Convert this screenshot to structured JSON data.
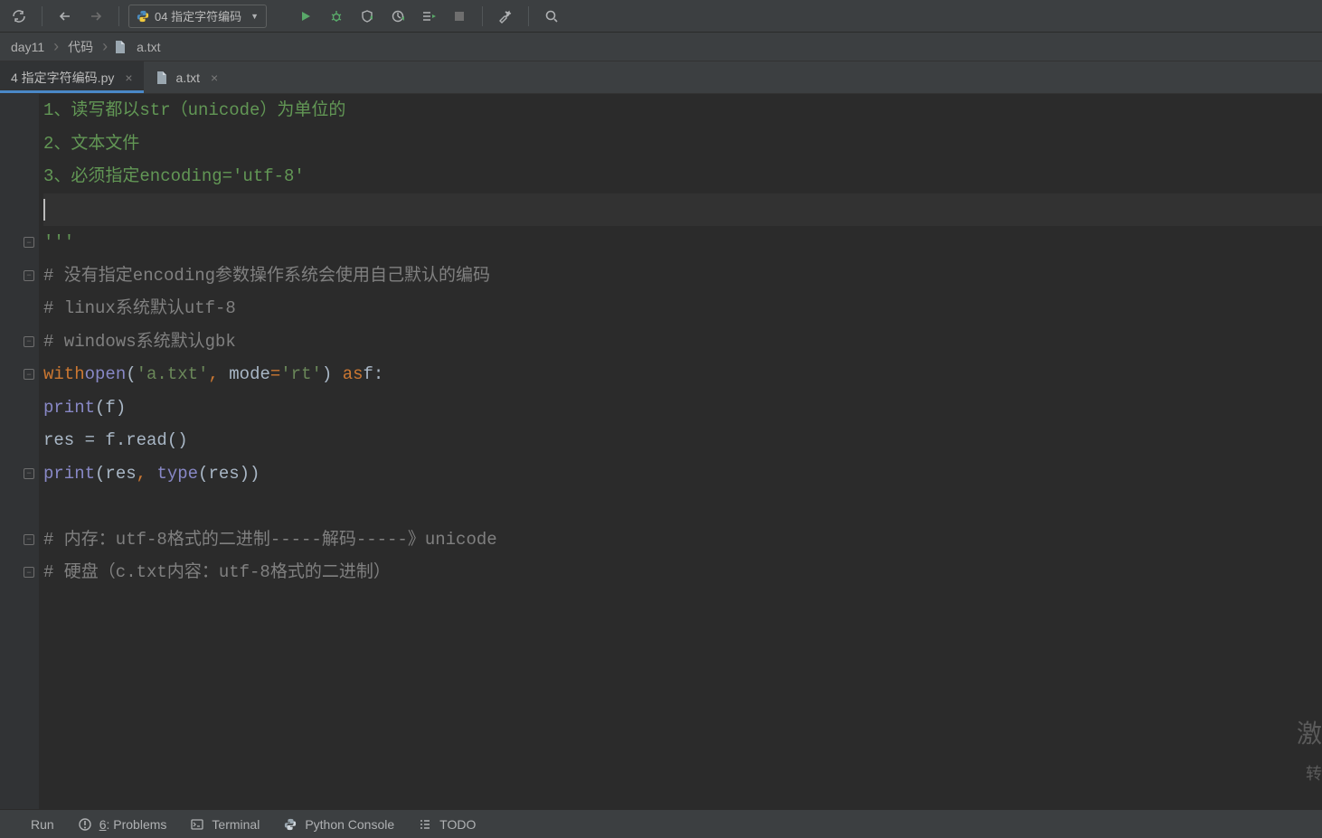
{
  "toolbar": {
    "run_config_label": "04 指定字符编码"
  },
  "breadcrumb": {
    "items": [
      "day11",
      "代码",
      "a.txt"
    ]
  },
  "tabs": [
    {
      "label": "4 指定字符编码.py",
      "active": true
    },
    {
      "label": "a.txt",
      "active": false
    }
  ],
  "code": {
    "lines": [
      {
        "t": "docstr",
        "text": "1、读写都以str（unicode）为单位的"
      },
      {
        "t": "docstr",
        "text": "2、文本文件"
      },
      {
        "t": "docstr",
        "text": "3、必须指定encoding='utf-8'"
      },
      {
        "t": "caret",
        "text": ""
      },
      {
        "t": "docstr",
        "text": "'''",
        "fold": "close"
      },
      {
        "t": "comment",
        "text": "# 没有指定encoding参数操作系统会使用自己默认的编码",
        "fold": "open"
      },
      {
        "t": "comment",
        "text": "# linux系统默认utf-8"
      },
      {
        "t": "comment",
        "text": "# windows系统默认gbk",
        "fold": "close"
      },
      {
        "t": "with",
        "fold": "open"
      },
      {
        "t": "print_f"
      },
      {
        "t": "read"
      },
      {
        "t": "print_res",
        "fold": "close"
      },
      {
        "t": "blank"
      },
      {
        "t": "comment",
        "text": "# 内存：utf-8格式的二进制-----解码-----》unicode",
        "fold": "open"
      },
      {
        "t": "comment",
        "text": "# 硬盘（c.txt内容：utf-8格式的二进制）",
        "fold": "close"
      }
    ],
    "with_parts": {
      "kw_with": "with",
      "fn_open": "open",
      "str_file": "'a.txt'",
      "arg_mode": "mode",
      "str_mode": "'rt'",
      "kw_as": "as",
      "ident_f": "f"
    },
    "print_f": {
      "fn": "print",
      "arg": "f"
    },
    "read": {
      "lhs": "res",
      "obj": "f",
      "meth": "read"
    },
    "print_res": {
      "fn": "print",
      "a1": "res",
      "fn2": "type",
      "a2": "res"
    }
  },
  "bottombar": {
    "run": "Run",
    "problems": "6: Problems",
    "terminal": "Terminal",
    "python_console": "Python Console",
    "todo": "TODO"
  },
  "watermark": {
    "line1": "激",
    "line2": "转"
  }
}
